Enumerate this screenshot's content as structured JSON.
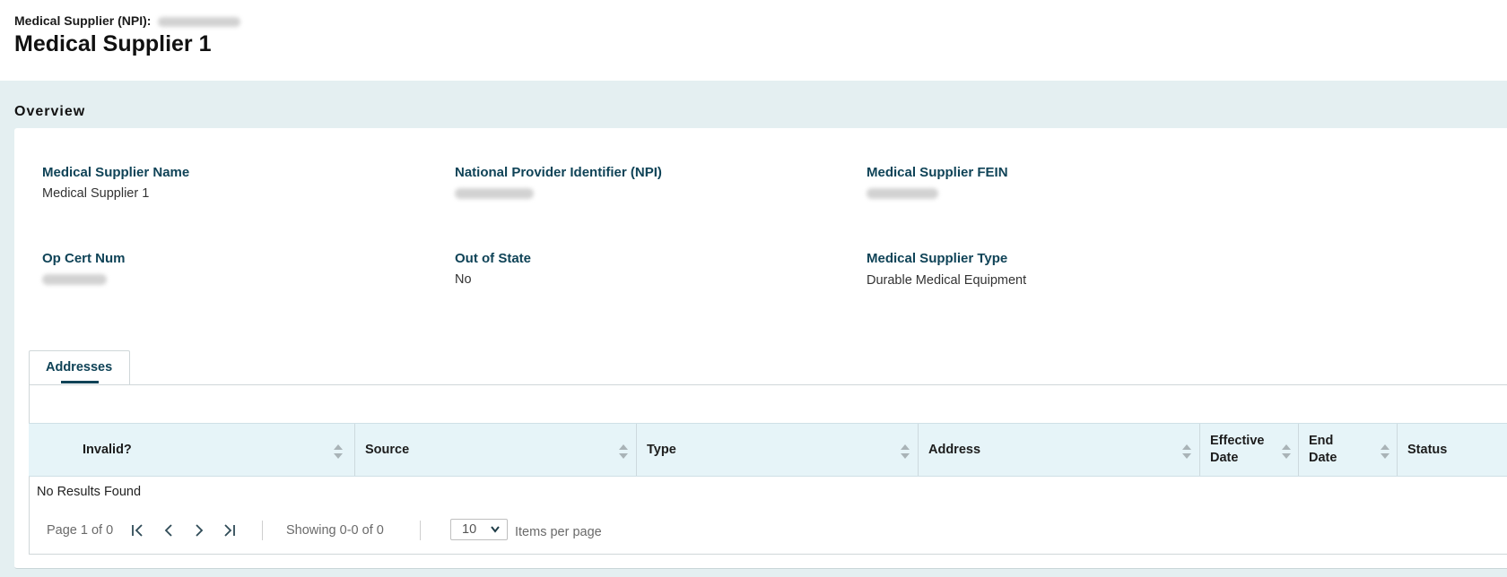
{
  "header": {
    "npi_label": "Medical Supplier (NPI):",
    "title": "Medical Supplier 1"
  },
  "overview": {
    "section_title": "Overview",
    "fields": [
      {
        "label": "Medical Supplier Name",
        "value": "Medical Supplier 1"
      },
      {
        "label": "National Provider Identifier (NPI)",
        "value": ""
      },
      {
        "label": "Medical Supplier FEIN",
        "value": ""
      },
      {
        "label": "Op Cert Num",
        "value": ""
      },
      {
        "label": "Out of State",
        "value": "No"
      },
      {
        "label": "Medical Supplier Type",
        "value": "Durable Medical Equipment"
      }
    ]
  },
  "tabs": [
    {
      "label": "Addresses",
      "active": true
    }
  ],
  "table": {
    "columns": [
      {
        "label": "Invalid?"
      },
      {
        "label": "Source"
      },
      {
        "label": "Type"
      },
      {
        "label": "Address"
      },
      {
        "label": "Effective Date"
      },
      {
        "label": "End Date"
      },
      {
        "label": "Status"
      }
    ],
    "empty_text": "No Results Found"
  },
  "pagination": {
    "page_text": "Page 1 of 0",
    "showing_text": "Showing 0-0 of 0",
    "page_size": "10",
    "items_per_page_label": "Items per page"
  },
  "colors": {
    "accent": "#0f4357",
    "band": "#e4eff1",
    "table_header": "#e6f4f8"
  }
}
